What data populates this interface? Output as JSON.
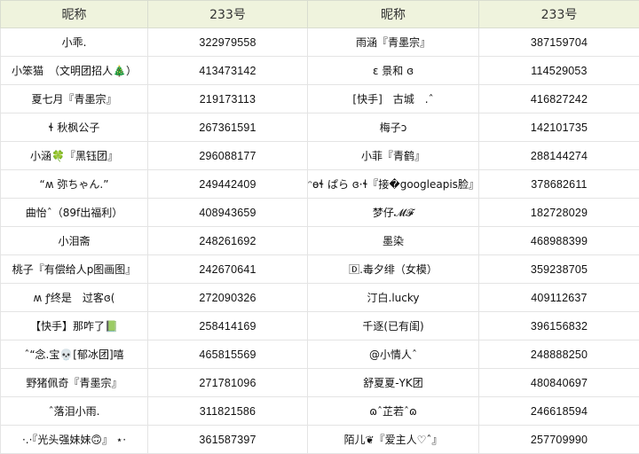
{
  "headers": [
    "昵称",
    "233号",
    "昵称",
    "233号"
  ],
  "rows": [
    {
      "n1": "小乖.",
      "id1": "322979558",
      "n2": "雨涵『青墨宗』",
      "id2": "387159704"
    },
    {
      "n1": "小笨猫　（文明团招人🎄）",
      "id1": "413473142",
      "n2": "ε 景和 ɞ",
      "id2": "114529053"
    },
    {
      "n1": "夏七月『青墨宗』",
      "id1": "219173113",
      "n2": "[快手]　古城　.ˆ",
      "id2": "416827242"
    },
    {
      "n1": "ɬ 秋枫公子",
      "id1": "267361591",
      "n2": "梅子ↄ",
      "id2": "142101735"
    },
    {
      "n1": "小涵🍀『黑钰团』",
      "id1": "296088177",
      "n2": "小菲『青鹤』",
      "id2": "288144274"
    },
    {
      "n1": "“ʍ 弥ちゃん.”",
      "id1": "249442409",
      "n2": "ᵔɵɬ ぱら ɞ·ɬ『接�googleapis脸』",
      "id2": "378682611"
    },
    {
      "n1": "曲怡ˆ（89f出福利）",
      "id1": "408943659",
      "n2": "梦仔𝓜𝓕",
      "id2": "182728029"
    },
    {
      "n1": "小泪斋",
      "id1": "248261692",
      "n2": "墨染",
      "id2": "468988399"
    },
    {
      "n1": "桃子『有偿给人p图画图』",
      "id1": "242670641",
      "n2": "🄳.毒夕绯（女模）",
      "id2": "359238705"
    },
    {
      "n1": "ʍ ꝭ终是　过客ɞ(",
      "id1": "272090326",
      "n2": "汀白.lucky",
      "id2": "409112637"
    },
    {
      "n1": "【快手】那咋了📗",
      "id1": "258414169",
      "n2": "千逐(已有闺)",
      "id2": "396156832"
    },
    {
      "n1": "ˆ“念.宝💀[郁冰团]嘻",
      "id1": "465815569",
      "n2": "@小情人ˆ",
      "id2": "248888250"
    },
    {
      "n1": "野猪佩奇『青墨宗』",
      "id1": "271781096",
      "n2": "舒夏夏-YK团",
      "id2": "480840697"
    },
    {
      "n1": "ˆ落泪小雨.",
      "id1": "311821586",
      "n2": "ɷˆ芷若ˆɷ",
      "id2": "246618594"
    },
    {
      "n1": "·.·『光头强妹妹🙃』 ⋆·",
      "id1": "361587397",
      "n2": "陌儿❦『爱主人♡ˆ』",
      "id2": "257709990"
    }
  ]
}
